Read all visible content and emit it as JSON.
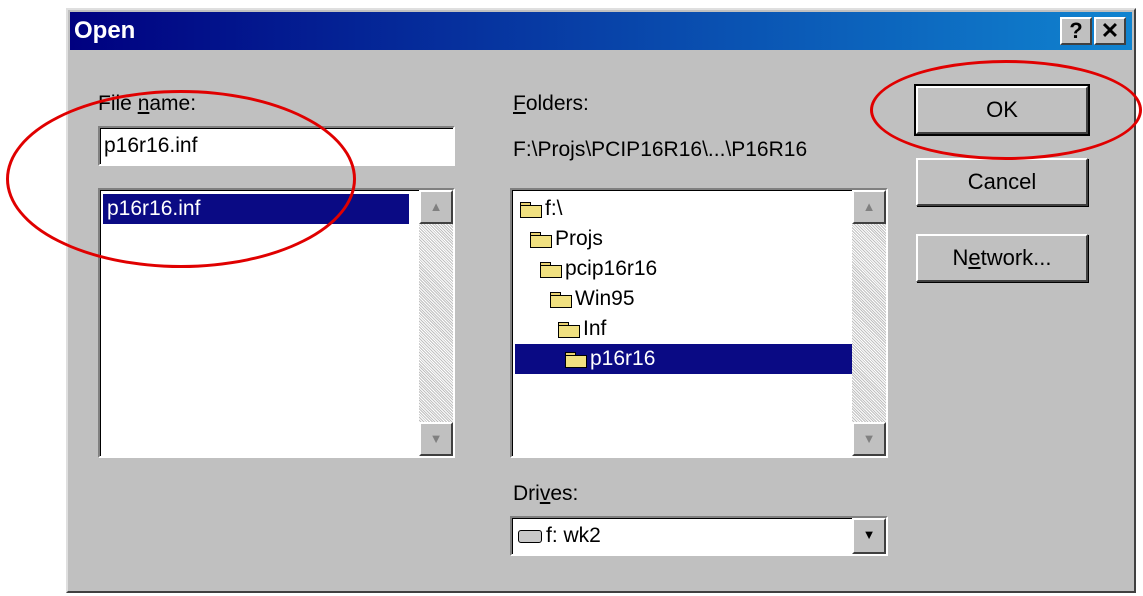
{
  "window": {
    "title": "Open",
    "help_button": "?",
    "close_button": "✕"
  },
  "file_name": {
    "label_pre": "File ",
    "label_accel": "n",
    "label_post": "ame:",
    "value": "p16r16.inf",
    "list": [
      "p16r16.inf"
    ]
  },
  "folders": {
    "label_accel": "F",
    "label_post": "olders:",
    "path": "F:\\Projs\\PCIP16R16\\...\\P16R16",
    "tree": [
      "f:\\",
      "Projs",
      "pcip16r16",
      "Win95",
      "Inf",
      "p16r16"
    ]
  },
  "drives": {
    "label_pre": "Dri",
    "label_accel": "v",
    "label_post": "es:",
    "selected": "f: wk2"
  },
  "buttons": {
    "ok": "OK",
    "cancel": "Cancel",
    "network_pre": "N",
    "network_accel": "e",
    "network_post": "twork..."
  },
  "highlight_color": "#e00000",
  "selection_color": "#0a0a84"
}
